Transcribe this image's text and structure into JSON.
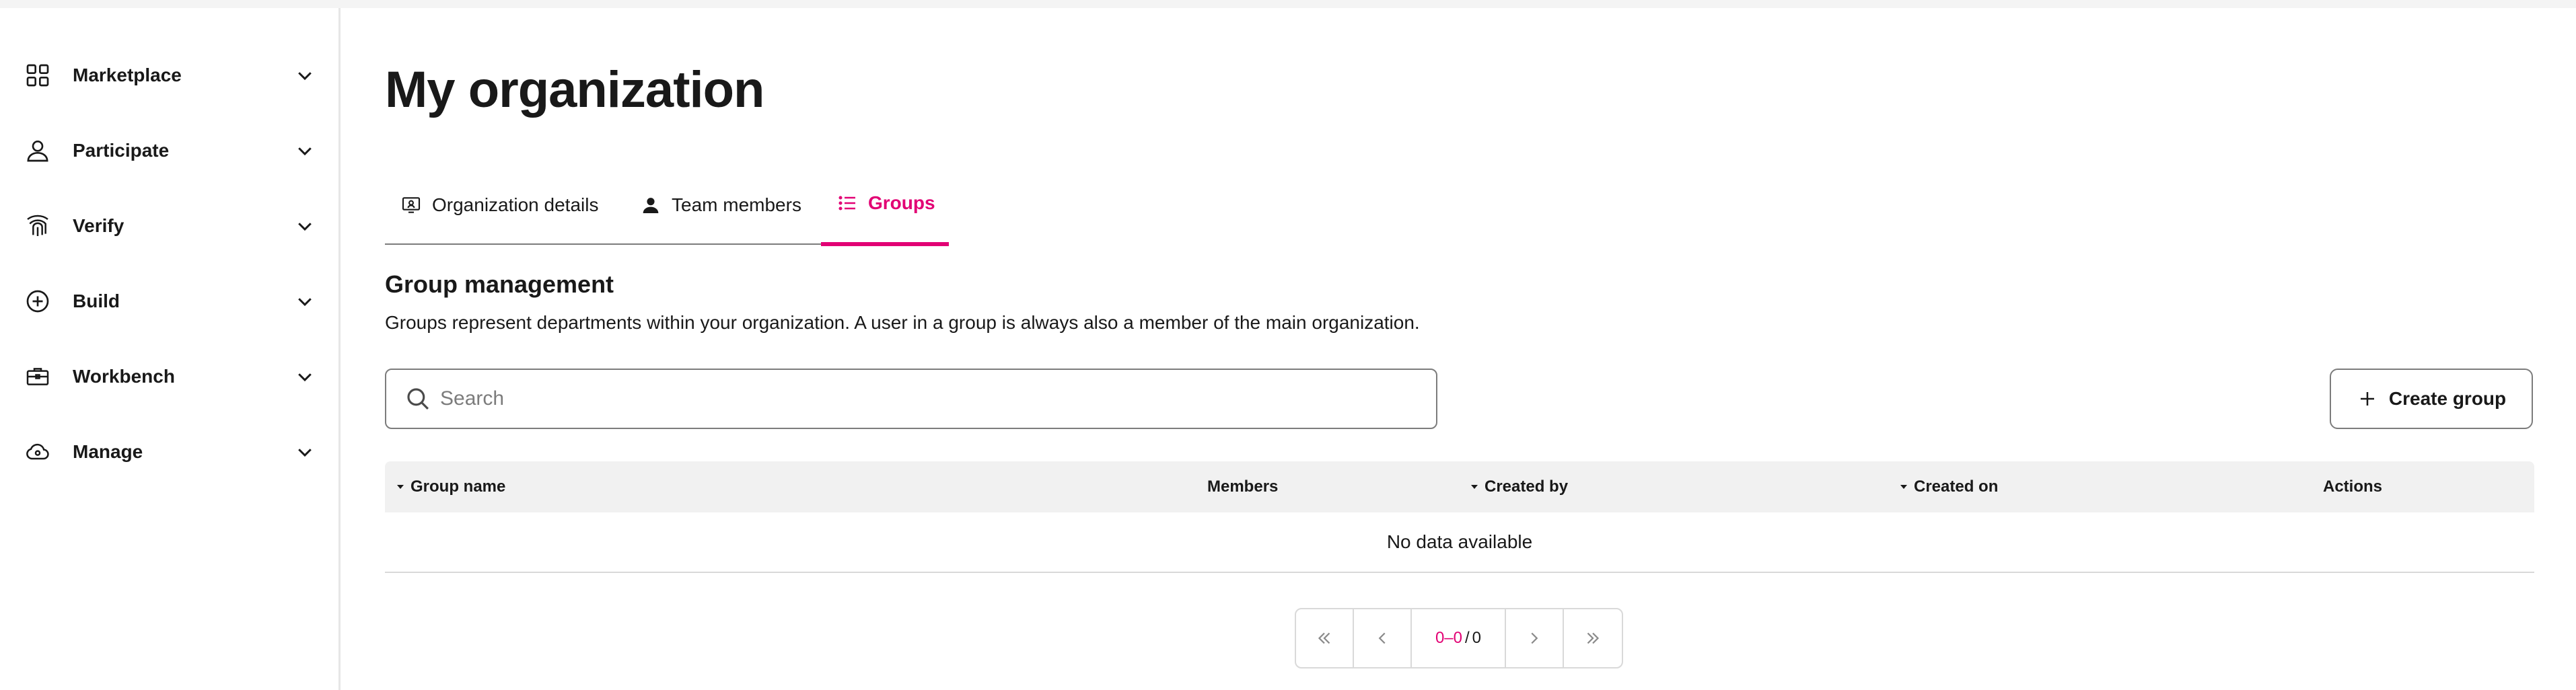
{
  "sidebar": {
    "items": [
      {
        "label": "Marketplace",
        "icon": "grid-icon"
      },
      {
        "label": "Participate",
        "icon": "person-icon"
      },
      {
        "label": "Verify",
        "icon": "fingerprint-icon"
      },
      {
        "label": "Build",
        "icon": "plus-circle-icon"
      },
      {
        "label": "Workbench",
        "icon": "toolbox-icon"
      },
      {
        "label": "Manage",
        "icon": "cloud-gear-icon"
      }
    ]
  },
  "main": {
    "title": "My organization",
    "tabs": [
      {
        "label": "Organization details",
        "icon": "monitor-user-icon",
        "active": false
      },
      {
        "label": "Team members",
        "icon": "person-icon",
        "active": false
      },
      {
        "label": "Groups",
        "icon": "list-icon",
        "active": true
      }
    ],
    "section_title": "Group management",
    "section_description": "Groups represent departments within your organization. A user in a group is always also a member of the main organization.",
    "search": {
      "placeholder": "Search",
      "value": ""
    },
    "create_button": "Create group",
    "table": {
      "columns": [
        "Group name",
        "Members",
        "Created by",
        "Created on",
        "Actions"
      ],
      "empty_message": "No data available"
    },
    "pagination": {
      "range": "0–0",
      "separator": "/",
      "total": "0"
    }
  },
  "colors": {
    "accent": "#e20074",
    "text": "#191919",
    "border": "#7c7c7c",
    "header_bg": "#f1f1f1"
  }
}
